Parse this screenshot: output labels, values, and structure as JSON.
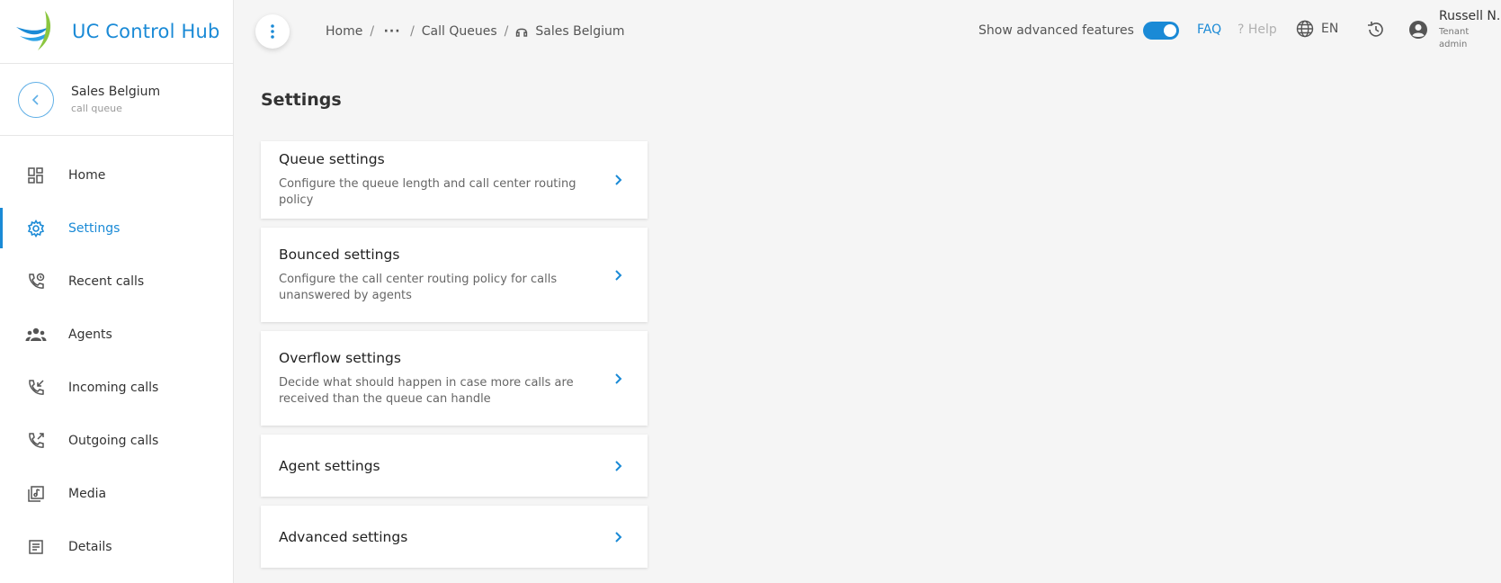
{
  "brand": {
    "name": "UC Control Hub"
  },
  "entity": {
    "name": "Sales Belgium",
    "type": "call queue"
  },
  "sidebar": {
    "items": [
      {
        "label": "Home",
        "icon": "dashboard-icon"
      },
      {
        "label": "Settings",
        "icon": "gear-icon",
        "active": true
      },
      {
        "label": "Recent calls",
        "icon": "phone-clock-icon"
      },
      {
        "label": "Agents",
        "icon": "group-icon"
      },
      {
        "label": "Incoming calls",
        "icon": "phone-incoming-icon"
      },
      {
        "label": "Outgoing calls",
        "icon": "phone-outgoing-icon"
      },
      {
        "label": "Media",
        "icon": "media-library-icon"
      },
      {
        "label": "Details",
        "icon": "document-icon"
      }
    ]
  },
  "breadcrumb": {
    "home": "Home",
    "more": "···",
    "call_queues": "Call Queues",
    "current": "Sales Belgium"
  },
  "header": {
    "advanced_label": "Show advanced features",
    "advanced_enabled": true,
    "faq": "FAQ",
    "help": "? Help",
    "language": "EN",
    "user_name": "Russell N.",
    "user_role": "Tenant admin"
  },
  "colors": {
    "accent": "#1a8ad6",
    "background": "#f5f5f5"
  },
  "main": {
    "title": "Settings",
    "cards": [
      {
        "title": "Queue settings",
        "description": "Configure the queue length and call center routing policy"
      },
      {
        "title": "Bounced settings",
        "description": "Configure the call center routing policy for calls unanswered by agents"
      },
      {
        "title": "Overflow settings",
        "description": "Decide what should happen in case more calls are received than the queue can handle"
      },
      {
        "title": "Agent settings",
        "description": ""
      },
      {
        "title": "Advanced settings",
        "description": ""
      }
    ]
  }
}
